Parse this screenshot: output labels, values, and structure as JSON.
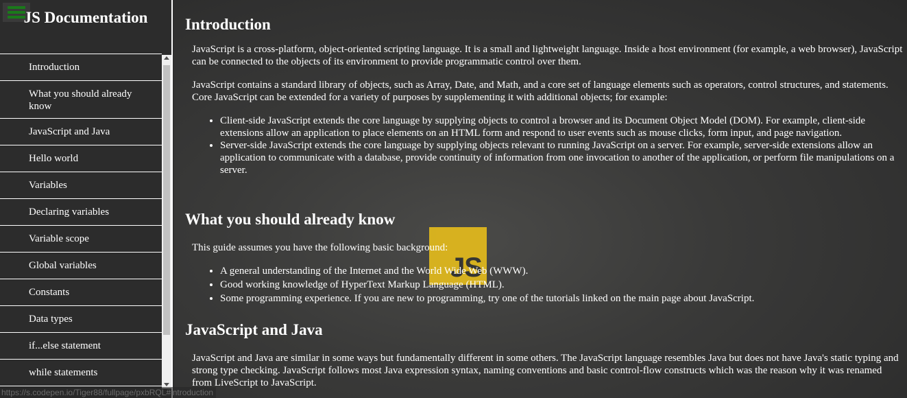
{
  "sidebar": {
    "title": "JS Documentation",
    "items": [
      {
        "label": "Introduction"
      },
      {
        "label": "What you should already know"
      },
      {
        "label": "JavaScript and Java"
      },
      {
        "label": "Hello world"
      },
      {
        "label": "Variables"
      },
      {
        "label": "Declaring variables"
      },
      {
        "label": "Variable scope"
      },
      {
        "label": "Global variables"
      },
      {
        "label": "Constants"
      },
      {
        "label": "Data types"
      },
      {
        "label": "if...else statement"
      },
      {
        "label": "while statements"
      }
    ]
  },
  "logo": {
    "text": "JS",
    "color": "#f0c419"
  },
  "main": {
    "intro": {
      "heading": "Introduction",
      "p1": "JavaScript is a cross-platform, object-oriented scripting language. It is a small and lightweight language. Inside a host environment (for example, a web browser), JavaScript can be connected to the objects of its environment to provide programmatic control over them.",
      "p2": "JavaScript contains a standard library of objects, such as Array, Date, and Math, and a core set of language elements such as operators, control structures, and statements. Core JavaScript can be extended for a variety of purposes by supplementing it with additional objects; for example:",
      "bullets": [
        "Client-side JavaScript extends the core language by supplying objects to control a browser and its Document Object Model (DOM). For example, client-side extensions allow an application to place elements on an HTML form and respond to user events such as mouse clicks, form input, and page navigation.",
        "Server-side JavaScript extends the core language by supplying objects relevant to running JavaScript on a server. For example, server-side extensions allow an application to communicate with a database, provide continuity of information from one invocation to another of the application, or perform file manipulations on a server."
      ]
    },
    "know": {
      "heading": "What you should already know",
      "p1": "This guide assumes you have the following basic background:",
      "bullets": [
        "A general understanding of the Internet and the World Wide Web (WWW).",
        "Good working knowledge of HyperText Markup Language (HTML).",
        "Some programming experience. If you are new to programming, try one of the tutorials linked on the main page about JavaScript."
      ]
    },
    "java": {
      "heading": "JavaScript and Java",
      "p1": "JavaScript and Java are similar in some ways but fundamentally different in some others. The JavaScript language resembles Java but does not have Java's static typing and strong type checking. JavaScript follows most Java expression syntax, naming conventions and basic control-flow constructs which was the reason why it was renamed from LiveScript to JavaScript."
    }
  },
  "status_url": "https://s.codepen.io/Tiger88/fullpage/pxbRQL#introduction"
}
